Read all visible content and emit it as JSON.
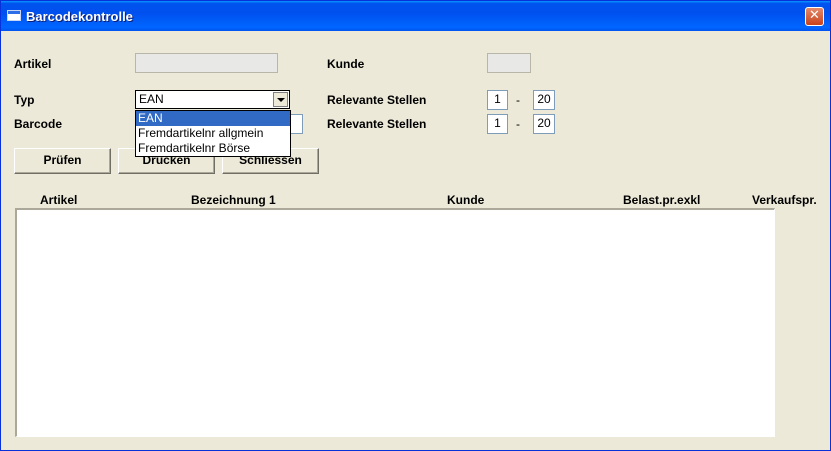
{
  "window": {
    "title": "Barcodekontrolle",
    "close_label": "✕"
  },
  "form": {
    "artikel_label": "Artikel",
    "artikel_value": "",
    "kunde_label": "Kunde",
    "kunde_value": "",
    "typ_label": "Typ",
    "typ_value": "EAN",
    "typ_options": [
      "EAN",
      "Fremdartikelnr allgmein",
      "Fremdartikelnr Börse"
    ],
    "barcode_label": "Barcode",
    "barcode_value": "",
    "relevante1_label": "Relevante Stellen",
    "relevante1_from": "1",
    "relevante1_to": "20",
    "relevante2_label": "Relevante Stellen",
    "relevante2_from": "1",
    "relevante2_to": "20",
    "range_separator": "-"
  },
  "buttons": {
    "pruefen": "Prüfen",
    "drucken": "Drucken",
    "schliessen": "Schliessen"
  },
  "table": {
    "columns": [
      "Artikel",
      "Bezeichnung 1",
      "Kunde",
      "Belast.pr.exkl",
      "Verkaufspr."
    ],
    "rows": []
  }
}
